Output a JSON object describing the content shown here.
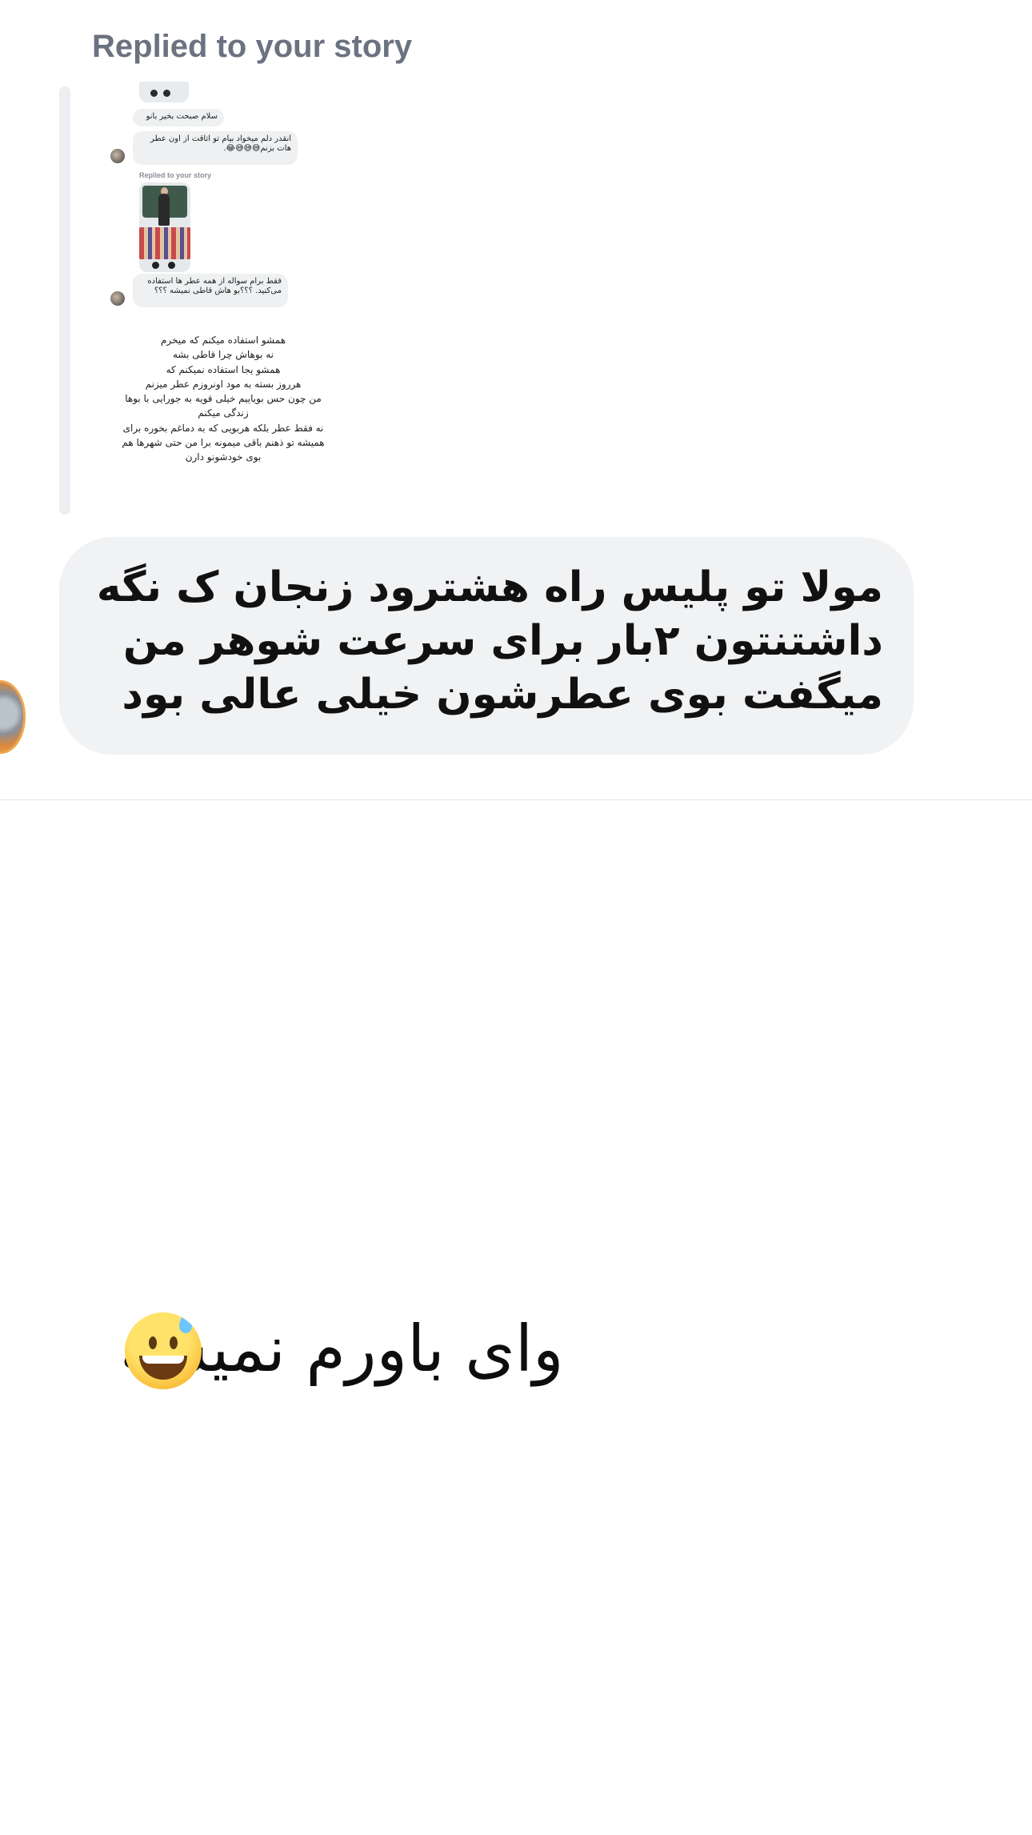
{
  "reply_header": "Replied to your story",
  "story_screenshot": {
    "greeting": "سلام صبحت بخیر بانو",
    "message_1": "انقدر دلم میخواد بیام تو اتاقت از اون عطر هات بزنم😅😅😅😂.",
    "replied_label": "Replied to your story",
    "message_2": "فقط برام سواله از همه عطر ها استفاده می‌کنید. ؟؟؟بو هاش قاطی نمیشه ؟؟؟",
    "caption_lines": [
      "همشو استفاده میکنم که میخرم",
      "نه بوهاش چرا قاطی بشه",
      "همشو یجا استفاده نمیکنم که",
      "هرروز بسته به مود اونروزم عطر میزنم",
      "من چون حس بویاییم خیلی قویه به جورایی با بوها",
      "زندگی میکنم",
      "نه فقط عطر بلکه هربویی که به دماغم بخوره برای",
      "همیشه تو ذهنم باقی میمونه برا من حتی شهرها هم",
      "بوی خودشونو دارن"
    ]
  },
  "message": {
    "text": "مولا تو پلیس راه هشترود زنجان ک نگه داشتنتون ۲بار برای سرعت شوهر من میگفت بوی عطرشون خیلی عالی بود"
  },
  "story_reply": {
    "text": "وای باورم نمیشه",
    "emoji": "grinning-face-with-sweat"
  },
  "colors": {
    "bubble_bg": "#f1f2f4",
    "label_gray": "#6b7280",
    "story_bar": "#eceef1"
  }
}
